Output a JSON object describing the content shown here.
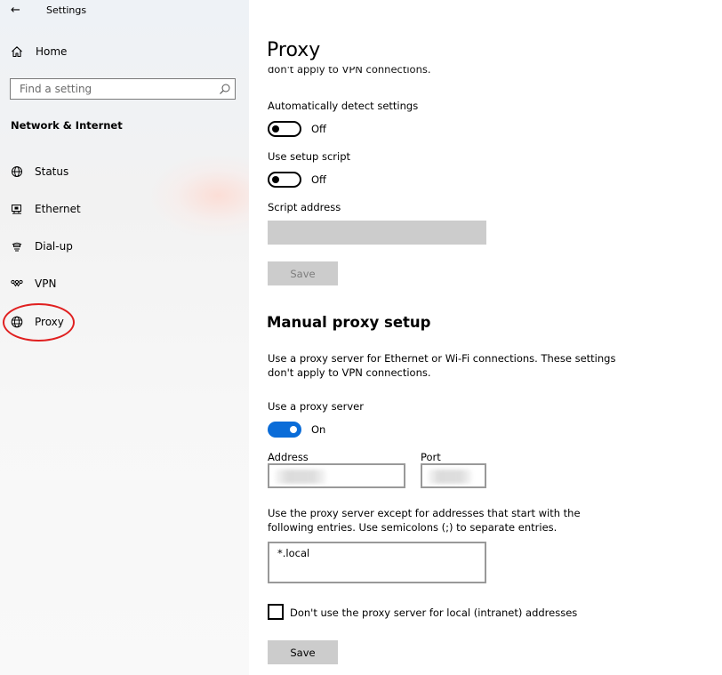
{
  "window": {
    "title": "Settings"
  },
  "sidebar": {
    "home_label": "Home",
    "search_placeholder": "Find a setting",
    "section_title": "Network & Internet",
    "items": [
      {
        "label": "Status",
        "icon": "globe-status-icon"
      },
      {
        "label": "Ethernet",
        "icon": "ethernet-icon"
      },
      {
        "label": "Dial-up",
        "icon": "dialup-icon"
      },
      {
        "label": "VPN",
        "icon": "vpn-icon"
      },
      {
        "label": "Proxy",
        "icon": "globe-icon",
        "selected": true
      }
    ]
  },
  "main": {
    "title": "Proxy",
    "cutoff_text": "don't apply to VPN connections.",
    "auto": {
      "detect_label": "Automatically detect settings",
      "detect_state": "Off",
      "script_label": "Use setup script",
      "script_state": "Off",
      "address_label": "Script address",
      "address_value": "",
      "save_label": "Save"
    },
    "manual": {
      "heading": "Manual proxy setup",
      "description": "Use a proxy server for Ethernet or Wi-Fi connections. These settings don't apply to VPN connections.",
      "use_proxy_label": "Use a proxy server",
      "use_proxy_state": "On",
      "address_label": "Address",
      "port_label": "Port",
      "exceptions_description": "Use the proxy server except for addresses that start with the following entries. Use semicolons (;) to separate entries.",
      "exceptions_value": "*.local",
      "local_checkbox_label": "Don't use the proxy server for local (intranet) addresses",
      "local_checkbox_checked": false,
      "save_label": "Save"
    }
  },
  "colors": {
    "accent": "#0a6cd8",
    "annotation": "#e02020",
    "button_bg": "#cccccc"
  }
}
